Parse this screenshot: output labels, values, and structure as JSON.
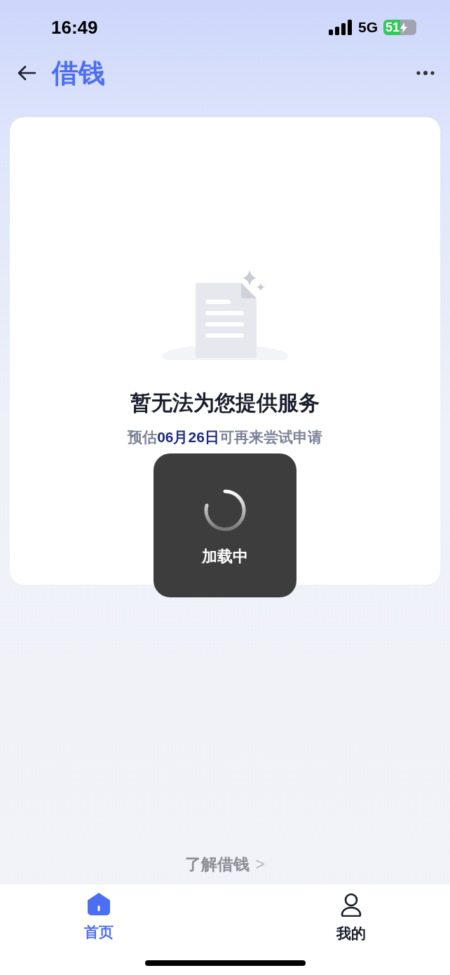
{
  "status_bar": {
    "time": "16:49",
    "network": "5G",
    "battery": "51"
  },
  "header": {
    "title": "借钱"
  },
  "empty_state": {
    "title": "暂无法为您提供服务",
    "subtitle": "预估**06月26日**可再来尝试申请"
  },
  "loading_toast": {
    "text": "加载中"
  },
  "footer_link": {
    "label": "了解借钱",
    "chevron": ">"
  },
  "tab_bar": [
    {
      "label": "首页",
      "kind": "home",
      "selected": true
    },
    {
      "label": "我的",
      "kind": "profile",
      "selected": false
    }
  ]
}
